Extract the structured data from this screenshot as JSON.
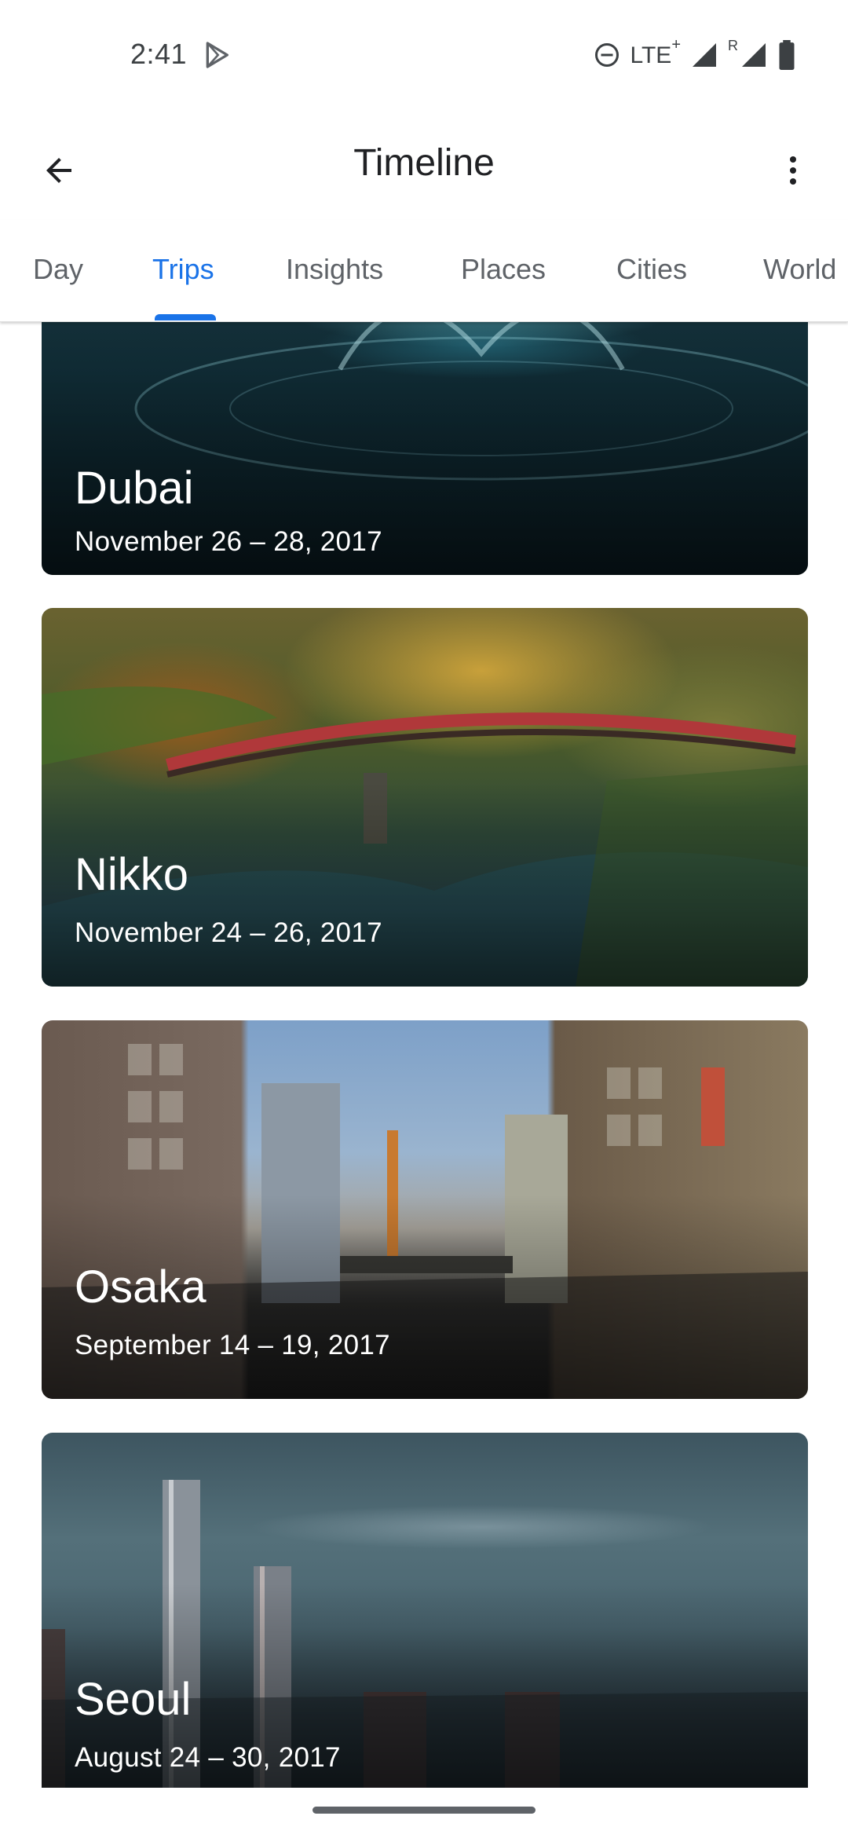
{
  "status_bar": {
    "time": "2:41",
    "network": "LTE",
    "network_suffix": "+",
    "roaming_mark": "R",
    "icons": [
      "play-store-icon",
      "do-not-disturb-icon",
      "signal-icon",
      "roaming-signal-icon",
      "battery-icon"
    ]
  },
  "app_bar": {
    "title": "Timeline",
    "back_icon": "arrow-back-icon",
    "menu_icon": "more-vert-icon"
  },
  "tabs": [
    {
      "label": "Day",
      "active": false
    },
    {
      "label": "Trips",
      "active": true
    },
    {
      "label": "Insights",
      "active": false
    },
    {
      "label": "Places",
      "active": false
    },
    {
      "label": "Cities",
      "active": false
    },
    {
      "label": "World",
      "active": false
    }
  ],
  "colors": {
    "accent": "#1a73e8",
    "tab_inactive": "#5f6368",
    "title": "#202124"
  },
  "trips": [
    {
      "name": "Dubai",
      "dates": "November 26 – 28, 2017"
    },
    {
      "name": "Nikko",
      "dates": "November 24 – 26, 2017"
    },
    {
      "name": "Osaka",
      "dates": "September 14 – 19, 2017"
    },
    {
      "name": "Seoul",
      "dates": "August 24 – 30, 2017"
    }
  ]
}
